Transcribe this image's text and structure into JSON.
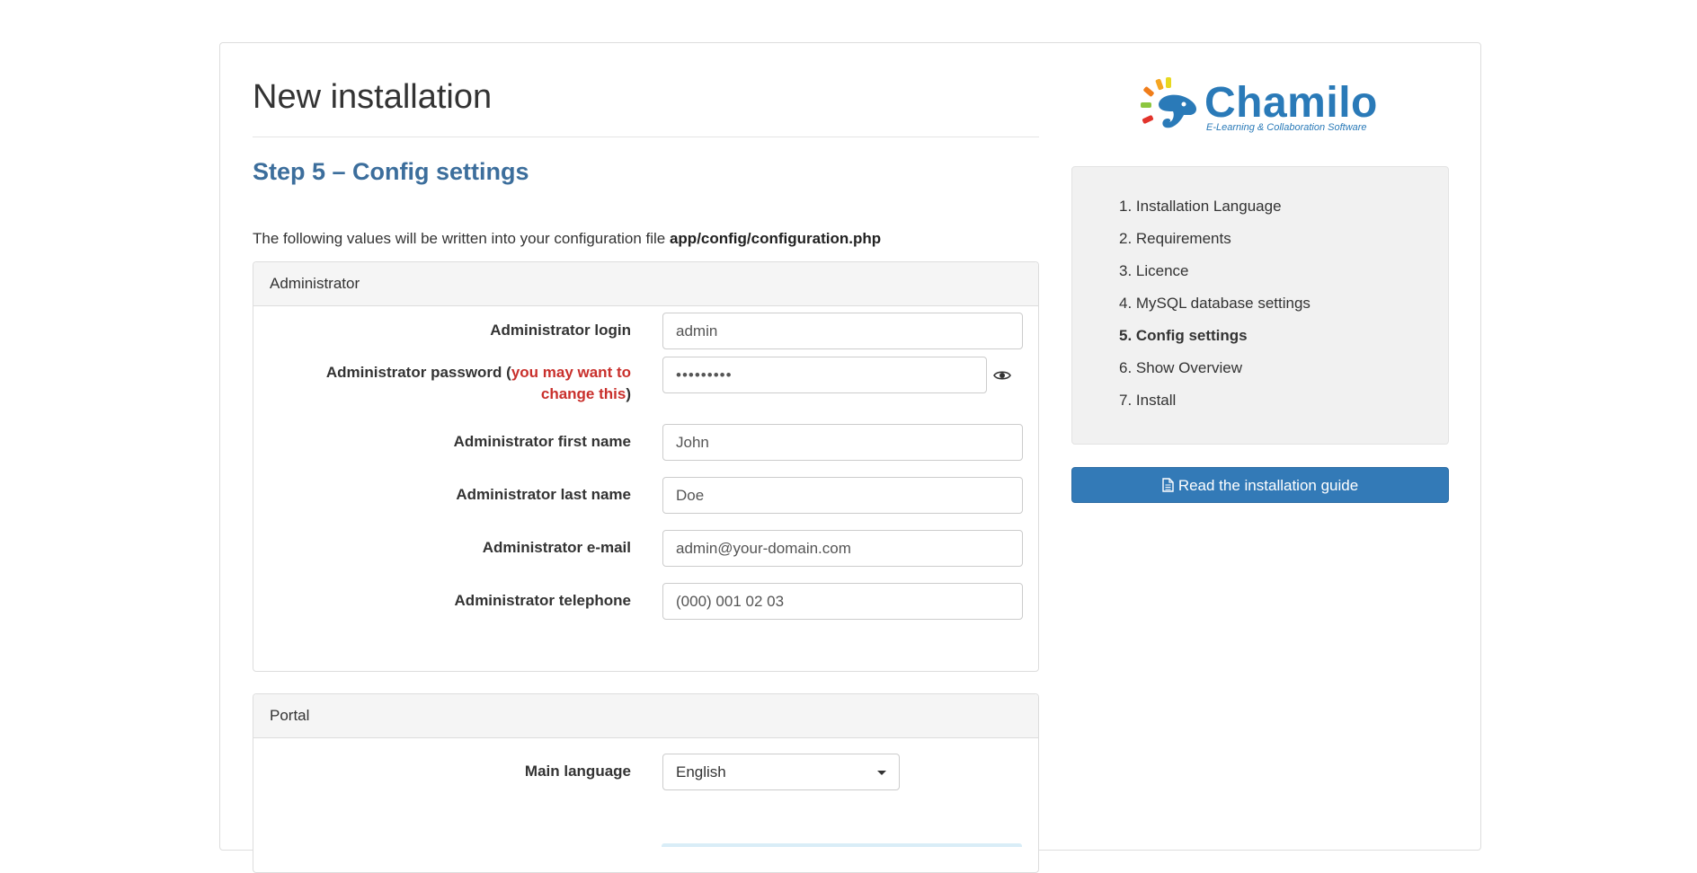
{
  "page": {
    "title": "New installation",
    "step_title": "Step 5 – Config settings",
    "intro_text": "The following values will be written into your configuration file ",
    "config_file": "app/config/configuration.php"
  },
  "admin_panel": {
    "heading": "Administrator",
    "fields": {
      "login": {
        "label": "Administrator login",
        "value": "admin"
      },
      "password": {
        "label_prefix": "Administrator password (",
        "label_warning": "you may want to change this",
        "label_suffix": ")",
        "value": "•••••••••"
      },
      "first_name": {
        "label": "Administrator first name",
        "value": "John"
      },
      "last_name": {
        "label": "Administrator last name",
        "value": "Doe"
      },
      "email": {
        "label": "Administrator e-mail",
        "value": "admin@your-domain.com"
      },
      "telephone": {
        "label": "Administrator telephone",
        "value": "(000) 001 02 03"
      }
    }
  },
  "portal_panel": {
    "heading": "Portal",
    "main_language": {
      "label": "Main language",
      "selected": "English"
    }
  },
  "sidebar": {
    "logo": {
      "word": "Chamilo",
      "tagline": "E-Learning & Collaboration Software"
    },
    "steps": [
      {
        "label": "1. Installation Language",
        "active": false
      },
      {
        "label": "2. Requirements",
        "active": false
      },
      {
        "label": "3. Licence",
        "active": false
      },
      {
        "label": "4. MySQL database settings",
        "active": false
      },
      {
        "label": "5. Config settings",
        "active": true
      },
      {
        "label": "6. Show Overview",
        "active": false
      },
      {
        "label": "7. Install",
        "active": false
      }
    ],
    "guide_button": "Read the installation guide"
  },
  "colors": {
    "primary": "#337ab7",
    "step_title": "#3c6e9c",
    "warning": "#c9302c",
    "logo_blue": "#2a7ab8"
  },
  "icons": [
    "eye-icon",
    "document-icon",
    "caret-down-icon",
    "chamilo-logo-icon"
  ]
}
